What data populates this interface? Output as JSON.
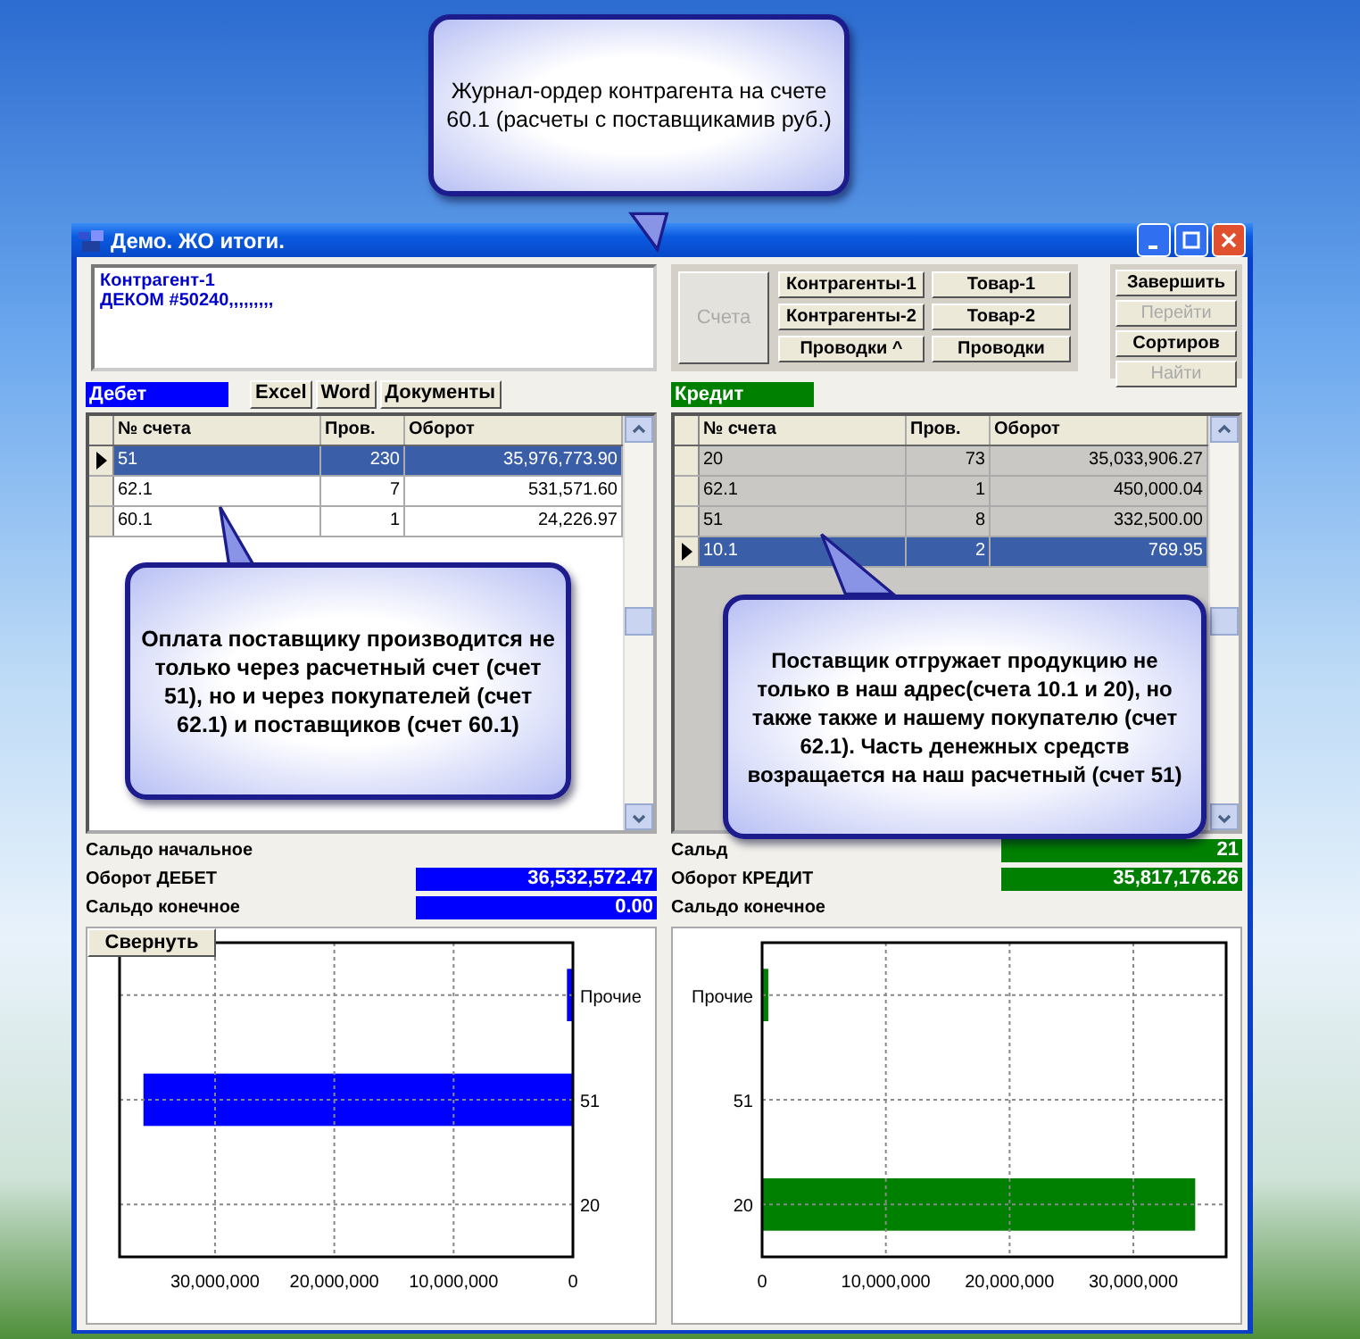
{
  "window": {
    "title": "Демо. ЖО итоги."
  },
  "counterparty_memo": [
    "Контрагент-1",
    "ДЕКОМ #50240,,,,,,,,,"
  ],
  "export_buttons": [
    "Excel",
    "Word",
    "Документы"
  ],
  "nav_panel": {
    "main": {
      "label": "Счета",
      "disabled": true
    },
    "buttons": [
      {
        "label": "Контрагенты-1",
        "disabled": false
      },
      {
        "label": "Товар-1",
        "disabled": false
      },
      {
        "label": "Контрагенты-2",
        "disabled": false
      },
      {
        "label": "Товар-2",
        "disabled": false
      },
      {
        "label": "Проводки ^",
        "disabled": false
      },
      {
        "label": "Проводки",
        "disabled": false
      }
    ]
  },
  "action_buttons": [
    {
      "label": "Завершить",
      "disabled": false
    },
    {
      "label": "Перейти",
      "disabled": true
    },
    {
      "label": "Сортиров",
      "disabled": false
    },
    {
      "label": "Найти",
      "disabled": true
    }
  ],
  "panels": [
    {
      "title": "Дебет",
      "color": "#0000ff",
      "columns": [
        "№ счета",
        "Пров.",
        "Оборот"
      ],
      "rows": [
        {
          "cells": [
            "51",
            "230",
            "35,976,773.90"
          ],
          "selected": true
        },
        {
          "cells": [
            "62.1",
            "7",
            "531,571.60"
          ],
          "selected": false
        },
        {
          "cells": [
            "60.1",
            "1",
            "24,226.97"
          ],
          "selected": false
        }
      ],
      "summary": [
        {
          "label": "Сальдо начальное"
        },
        {
          "label": "Оборот ДЕБЕТ",
          "value": "36,532,572.47"
        },
        {
          "label": "Сальдо конечное",
          "value": "0.00"
        }
      ],
      "collapse_button": "Свернуть",
      "chart_data": {
        "type": "bar",
        "orientation": "horizontal",
        "categories": [
          "Прочие",
          "51",
          "20"
        ],
        "grid": true,
        "series": [
          {
            "color": "#0000ff",
            "values": [
              500000,
              36000000,
              0
            ]
          }
        ],
        "xlim": [
          38000000,
          0
        ],
        "xticks": [
          {
            "value": 30000000,
            "label": "30,000,000"
          },
          {
            "value": 20000000,
            "label": "20,000,000"
          },
          {
            "value": 10000000,
            "label": "10,000,000"
          },
          {
            "value": 0,
            "label": "0"
          }
        ]
      }
    },
    {
      "title": "Кредит",
      "color": "#008000",
      "columns": [
        "№ счета",
        "Пров.",
        "Оборот"
      ],
      "rows": [
        {
          "cells": [
            "20",
            "73",
            "35,033,906.27"
          ],
          "selected": false
        },
        {
          "cells": [
            "62.1",
            "1",
            "450,000.04"
          ],
          "selected": false
        },
        {
          "cells": [
            "51",
            "8",
            "332,500.00"
          ],
          "selected": false
        },
        {
          "cells": [
            "10.1",
            "2",
            "769.95"
          ],
          "selected": true
        }
      ],
      "summary": [
        {
          "label": "Сальд",
          "value": "21"
        },
        {
          "label": "Оборот КРЕДИТ",
          "value": "35,817,176.26"
        },
        {
          "label": "Сальдо конечное"
        }
      ],
      "chart_data": {
        "type": "bar",
        "orientation": "horizontal",
        "categories": [
          "Прочие",
          "51",
          "20"
        ],
        "grid": true,
        "series": [
          {
            "color": "#008000",
            "values": [
              500000,
              0,
              35000000
            ]
          }
        ],
        "xlim": [
          0,
          37500000
        ],
        "xticks": [
          {
            "value": 0,
            "label": "0"
          },
          {
            "value": 10000000,
            "label": "10,000,000"
          },
          {
            "value": 20000000,
            "label": "20,000,000"
          },
          {
            "value": 30000000,
            "label": "30,000,000"
          }
        ]
      }
    }
  ],
  "callouts": [
    {
      "kind": "top",
      "text": "Журнал-ордер контрагента на счете 60.1 (расчеты с поставщикамив руб.)"
    },
    {
      "kind": "left",
      "text": "Оплата поставщику производится не только через расчетный счет (счет 51), но и через покупателей (счет 62.1) и поставщиков (счет 60.1)"
    },
    {
      "kind": "right",
      "text": "Поставщик отгружает продукцию не только в наш адрес(счета 10.1 и 20), но также также и нашему покупателю (счет 62.1). Часть денежных средств возращается на наш расчетный (счет 51)"
    }
  ]
}
